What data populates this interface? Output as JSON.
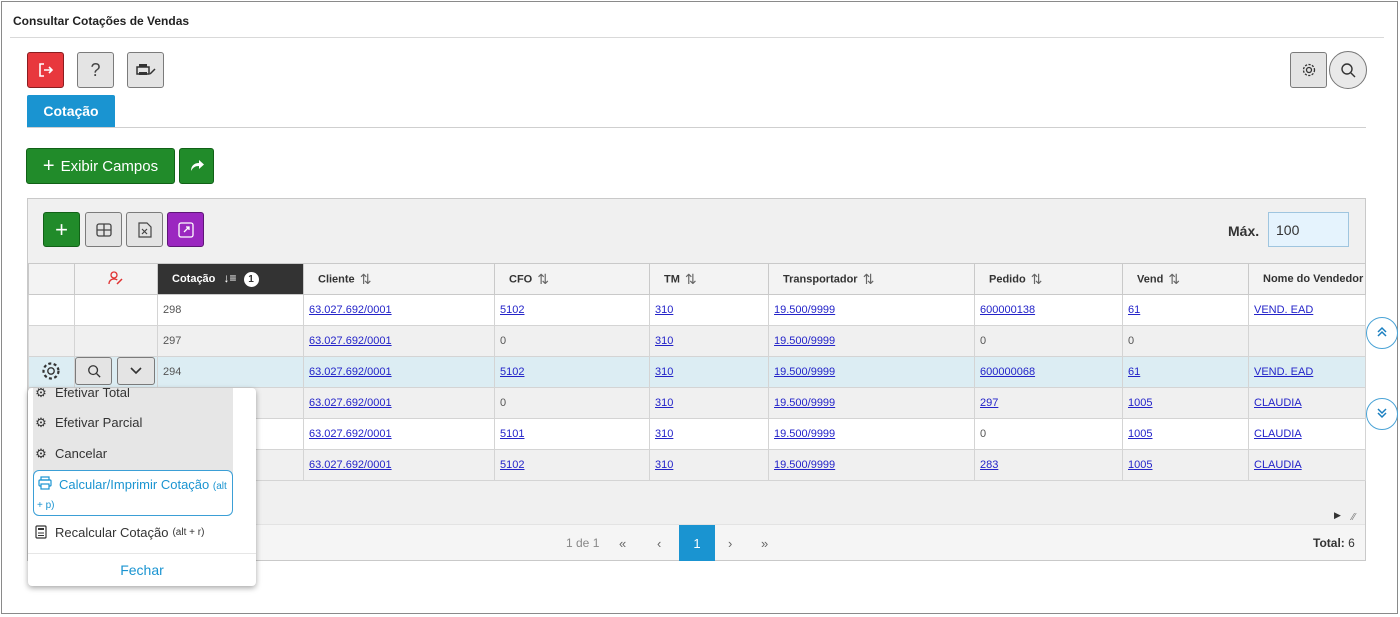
{
  "page": {
    "title": "Consultar Cotações de Vendas"
  },
  "toolbar": {
    "exit_icon": "exit-icon",
    "help_label": "?",
    "print_icon": "printer-icon",
    "settings_icon": "gear-icon",
    "search_icon": "search-icon"
  },
  "tabs": [
    {
      "label": "Cotação",
      "active": true
    }
  ],
  "actions": {
    "show_fields_label": "Exibir Campos"
  },
  "grid": {
    "max_label": "Máx.",
    "max_value": "100",
    "sorted_badge": "1",
    "columns": [
      "",
      "",
      "Cotação",
      "Cliente",
      "CFO",
      "TM",
      "Transportador",
      "Pedido",
      "Vend",
      "Nome do Vendedor"
    ],
    "rows": [
      {
        "cotacao": "298",
        "cliente": "63.027.692/0001",
        "cfo": "5102",
        "tm": "310",
        "transportador": "19.500/9999",
        "pedido": "600000138",
        "vend": "61",
        "nome": "VEND. EAD"
      },
      {
        "cotacao": "297",
        "cliente": "63.027.692/0001",
        "cfo": "0",
        "tm": "310",
        "transportador": "19.500/9999",
        "pedido": "0",
        "vend": "0",
        "nome": ""
      },
      {
        "cotacao": "294",
        "cliente": "63.027.692/0001",
        "cfo": "5102",
        "tm": "310",
        "transportador": "19.500/9999",
        "pedido": "600000068",
        "vend": "61",
        "nome": "VEND. EAD"
      },
      {
        "cotacao": "",
        "cliente": "63.027.692/0001",
        "cfo": "0",
        "tm": "310",
        "transportador": "19.500/9999",
        "pedido": "297",
        "vend": "1005",
        "nome": "CLAUDIA"
      },
      {
        "cotacao": "",
        "cliente": "63.027.692/0001",
        "cfo": "5101",
        "tm": "310",
        "transportador": "19.500/9999",
        "pedido": "0",
        "vend": "1005",
        "nome": "CLAUDIA"
      },
      {
        "cotacao": "",
        "cliente": "63.027.692/0001",
        "cfo": "5102",
        "tm": "310",
        "transportador": "19.500/9999",
        "pedido": "283",
        "vend": "1005",
        "nome": "CLAUDIA"
      }
    ]
  },
  "pager": {
    "page_info": "1 de 1",
    "current_page": "1",
    "total_label": "Total:",
    "total_value": "6"
  },
  "menu": {
    "items": [
      {
        "label": "Efetivar Total"
      },
      {
        "label": "Efetivar Parcial"
      },
      {
        "label": "Cancelar"
      },
      {
        "label": "Calcular/Imprimir Cotação",
        "shortcut_a": "(alt",
        "shortcut_b": "+ p)"
      },
      {
        "label": "Recalcular Cotação",
        "shortcut": "(alt + r)"
      }
    ],
    "close_label": "Fechar"
  }
}
